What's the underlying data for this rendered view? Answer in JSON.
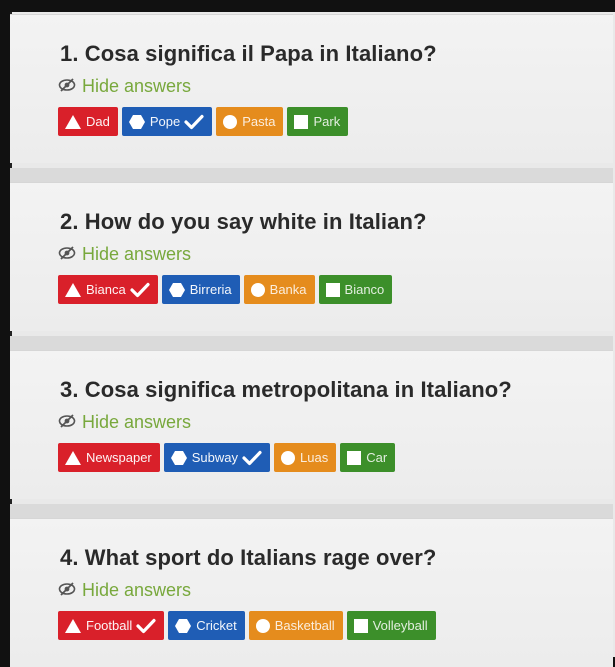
{
  "hide_label": "Hide answers",
  "questions": [
    {
      "title": "1. Cosa significa il Papa in Italiano?",
      "answers": [
        {
          "label": "Dad",
          "color": "red",
          "shape": "triangle",
          "correct": false
        },
        {
          "label": "Pope",
          "color": "blue",
          "shape": "hexagon",
          "correct": true
        },
        {
          "label": "Pasta",
          "color": "orange",
          "shape": "circle",
          "correct": false
        },
        {
          "label": "Park",
          "color": "green",
          "shape": "square",
          "correct": false
        }
      ]
    },
    {
      "title": "2. How do you say white in Italian?",
      "answers": [
        {
          "label": "Bianca",
          "color": "red",
          "shape": "triangle",
          "correct": true
        },
        {
          "label": "Birreria",
          "color": "blue",
          "shape": "hexagon",
          "correct": false
        },
        {
          "label": "Banka",
          "color": "orange",
          "shape": "circle",
          "correct": false
        },
        {
          "label": "Bianco",
          "color": "green",
          "shape": "square",
          "correct": false
        }
      ]
    },
    {
      "title": "3. Cosa significa metropolitana in Italiano?",
      "answers": [
        {
          "label": "Newspaper",
          "color": "red",
          "shape": "triangle",
          "correct": false
        },
        {
          "label": "Subway",
          "color": "blue",
          "shape": "hexagon",
          "correct": true
        },
        {
          "label": "Luas",
          "color": "orange",
          "shape": "circle",
          "correct": false
        },
        {
          "label": "Car",
          "color": "green",
          "shape": "square",
          "correct": false
        }
      ]
    },
    {
      "title": "4. What sport do Italians rage over?",
      "answers": [
        {
          "label": "Football",
          "color": "red",
          "shape": "triangle",
          "correct": true
        },
        {
          "label": "Cricket",
          "color": "blue",
          "shape": "hexagon",
          "correct": false
        },
        {
          "label": "Basketball",
          "color": "orange",
          "shape": "circle",
          "correct": false
        },
        {
          "label": "Volleyball",
          "color": "green",
          "shape": "square",
          "correct": false
        }
      ]
    }
  ],
  "colors": {
    "red": "#d9202a",
    "blue": "#1f5db5",
    "orange": "#e58c1d",
    "green": "#3c8f2a",
    "hide_text": "#78a83c",
    "title_text": "#2a2a2a"
  },
  "icons": {
    "hide": "eye-slash-icon",
    "correct": "checkmark-icon",
    "shapes": [
      "triangle-icon",
      "hexagon-icon",
      "circle-icon",
      "square-icon"
    ]
  }
}
